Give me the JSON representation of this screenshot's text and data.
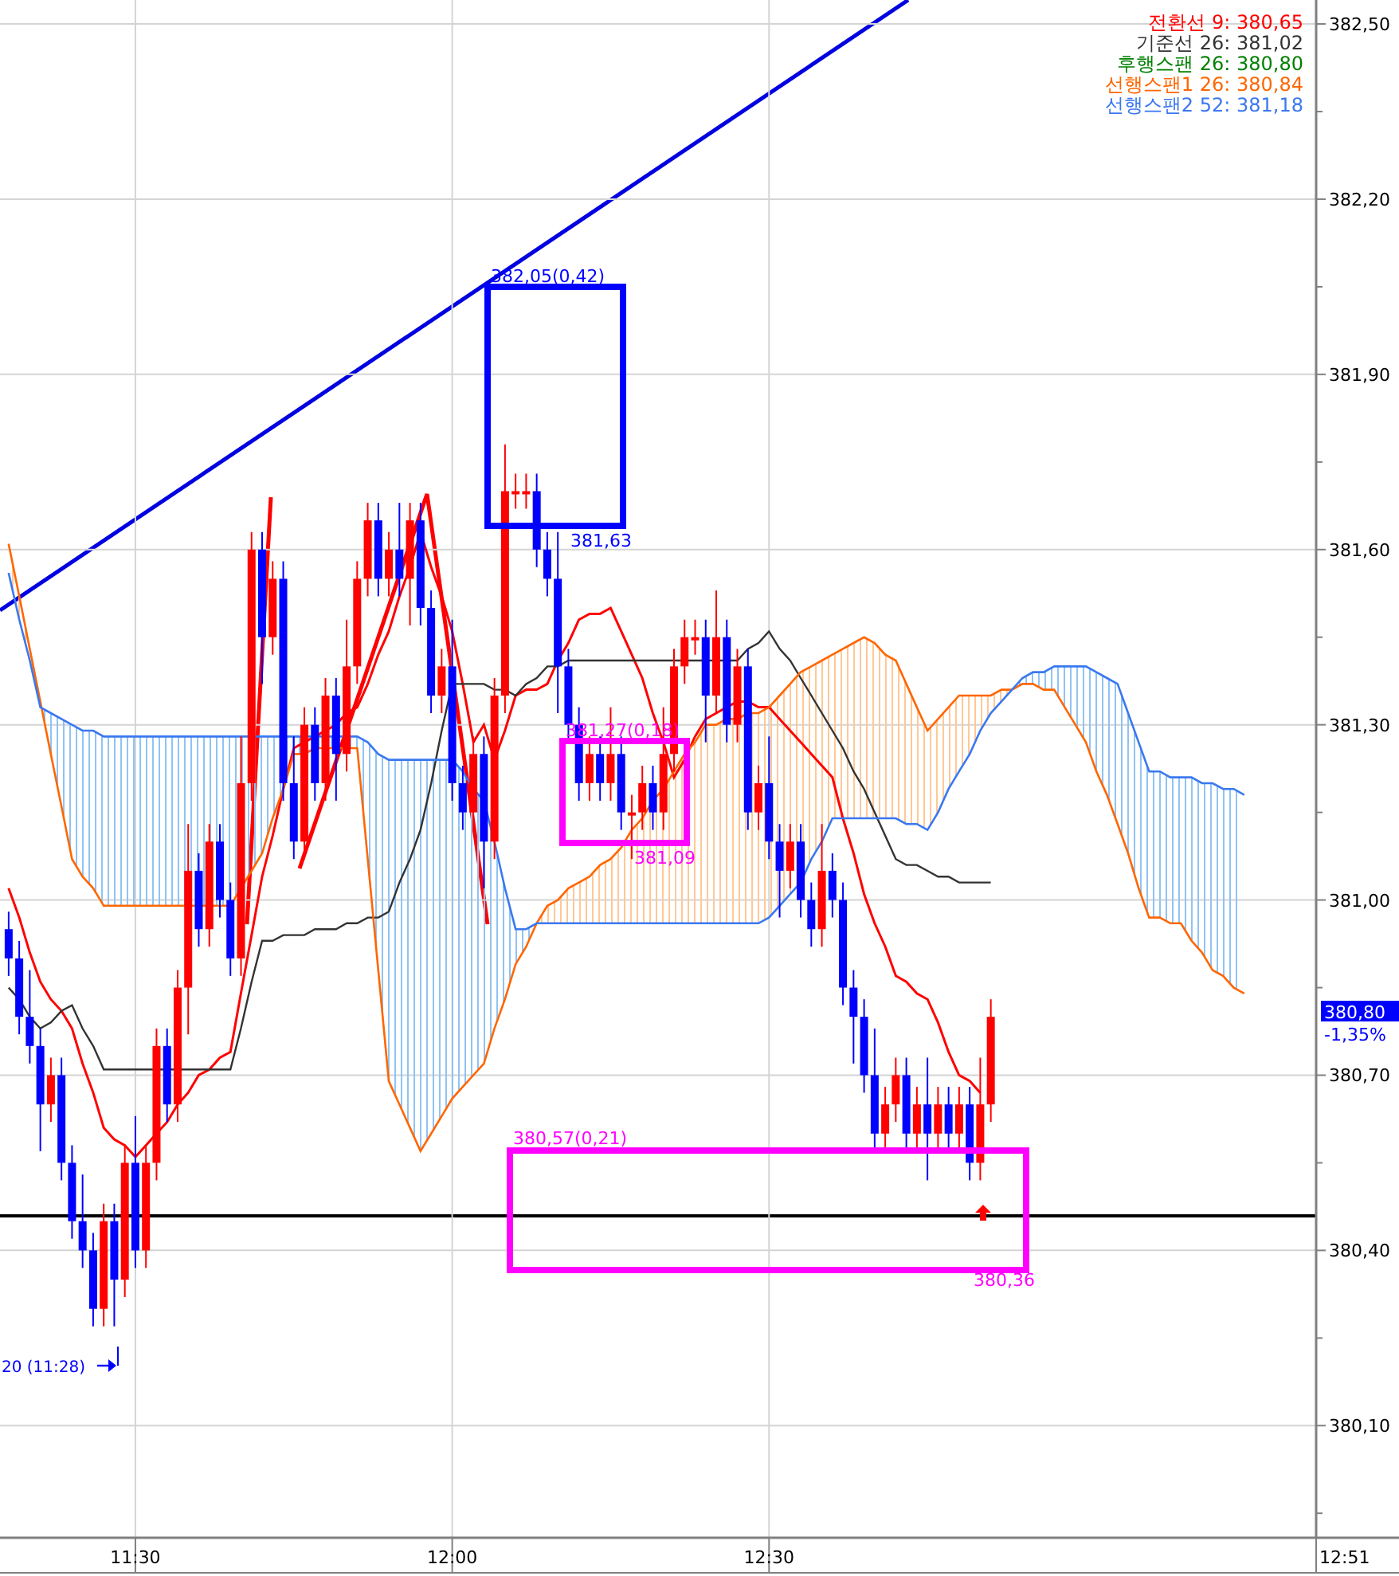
{
  "legend": [
    {
      "label": "전환선 9: 380,65",
      "color": "#ff0000"
    },
    {
      "label": "기준선 26: 381,02",
      "color": "#333333"
    },
    {
      "label": "후행스팬 26: 380,80",
      "color": "#008000"
    },
    {
      "label": "선행스팬1 26: 380,84",
      "color": "#ff6600"
    },
    {
      "label": "선행스팬2 52: 381,18",
      "color": "#3a78f0"
    }
  ],
  "chart_data": {
    "type": "candlestick",
    "grid": true,
    "ylim": [
      379.908,
      382.541
    ],
    "yticks": [
      {
        "value": 382.5,
        "label": "382,50"
      },
      {
        "value": 382.2,
        "label": "382,20"
      },
      {
        "value": 381.9,
        "label": "381,90"
      },
      {
        "value": 381.6,
        "label": "381,60"
      },
      {
        "value": 381.3,
        "label": "381,30"
      },
      {
        "value": 381.0,
        "label": "381,00"
      },
      {
        "value": 380.7,
        "label": "380,70"
      },
      {
        "value": 380.4,
        "label": "380,40"
      },
      {
        "value": 380.1,
        "label": "380,10"
      }
    ],
    "xlim": [
      677.18,
      809.65
    ],
    "xticks": [
      {
        "value": 690,
        "label": "11:30"
      },
      {
        "value": 720,
        "label": "12:00"
      },
      {
        "value": 750,
        "label": "12:30"
      }
    ],
    "x": [
      678,
      679,
      680,
      681,
      682,
      683,
      684,
      685,
      686,
      687,
      688,
      689,
      690,
      691,
      692,
      693,
      694,
      695,
      696,
      697,
      698,
      699,
      700,
      701,
      702,
      703,
      704,
      705,
      706,
      707,
      708,
      709,
      710,
      711,
      712,
      713,
      714,
      715,
      716,
      717,
      718,
      719,
      720,
      721,
      722,
      723,
      724,
      725,
      726,
      727,
      728,
      729,
      730,
      731,
      732,
      733,
      734,
      735,
      736,
      737,
      738,
      739,
      740,
      741,
      742,
      743,
      744,
      745,
      746,
      747,
      748,
      749,
      750,
      751,
      752,
      753,
      754,
      755,
      756,
      757,
      758,
      759,
      760,
      761,
      762,
      763,
      764,
      765,
      766,
      767,
      768,
      769,
      770,
      771,
      772,
      773,
      774,
      775,
      776,
      777,
      778,
      779,
      780,
      781,
      782,
      783,
      784,
      785,
      786,
      787,
      788,
      789,
      790,
      791,
      792,
      793,
      794,
      795
    ],
    "ohlc": [
      [
        380.95,
        380.98,
        380.87,
        380.9
      ],
      [
        380.9,
        380.93,
        380.77,
        380.8
      ],
      [
        380.8,
        380.88,
        380.72,
        380.75
      ],
      [
        380.75,
        380.78,
        380.57,
        380.65
      ],
      [
        380.65,
        380.73,
        380.62,
        380.7
      ],
      [
        380.7,
        380.73,
        380.52,
        380.55
      ],
      [
        380.55,
        380.58,
        380.42,
        380.45
      ],
      [
        380.45,
        380.53,
        380.37,
        380.4
      ],
      [
        380.4,
        380.43,
        380.27,
        380.3
      ],
      [
        380.3,
        380.48,
        380.27,
        380.45
      ],
      [
        380.45,
        380.48,
        380.27,
        380.35
      ],
      [
        380.35,
        380.58,
        380.32,
        380.55
      ],
      [
        380.55,
        380.63,
        380.37,
        380.4
      ],
      [
        380.4,
        380.58,
        380.37,
        380.55
      ],
      [
        380.55,
        380.78,
        380.52,
        380.75
      ],
      [
        380.75,
        380.78,
        380.62,
        380.65
      ],
      [
        380.65,
        380.88,
        380.62,
        380.85
      ],
      [
        380.85,
        381.13,
        380.77,
        381.05
      ],
      [
        381.05,
        381.08,
        380.92,
        380.95
      ],
      [
        380.95,
        381.13,
        380.92,
        381.1
      ],
      [
        381.1,
        381.13,
        380.97,
        381.0
      ],
      [
        381.0,
        381.03,
        380.87,
        380.9
      ],
      [
        380.9,
        381.28,
        380.87,
        381.2
      ],
      [
        381.2,
        381.63,
        381.17,
        381.6
      ],
      [
        381.6,
        381.63,
        381.37,
        381.45
      ],
      [
        381.45,
        381.58,
        381.42,
        381.55
      ],
      [
        381.55,
        381.58,
        381.17,
        381.2
      ],
      [
        381.2,
        381.28,
        381.07,
        381.1
      ],
      [
        381.1,
        381.33,
        381.07,
        381.3
      ],
      [
        381.3,
        381.33,
        381.17,
        381.2
      ],
      [
        381.2,
        381.38,
        381.17,
        381.35
      ],
      [
        381.35,
        381.38,
        381.17,
        381.25
      ],
      [
        381.25,
        381.48,
        381.22,
        381.4
      ],
      [
        381.4,
        381.58,
        381.37,
        381.55
      ],
      [
        381.55,
        381.68,
        381.52,
        381.65
      ],
      [
        381.65,
        381.68,
        381.52,
        381.55
      ],
      [
        381.55,
        381.63,
        381.52,
        381.6
      ],
      [
        381.6,
        381.68,
        381.52,
        381.55
      ],
      [
        381.55,
        381.68,
        381.47,
        381.65
      ],
      [
        381.65,
        381.68,
        381.47,
        381.5
      ],
      [
        381.5,
        381.53,
        381.32,
        381.35
      ],
      [
        381.35,
        381.43,
        381.32,
        381.4
      ],
      [
        381.4,
        381.48,
        381.17,
        381.2
      ],
      [
        381.2,
        381.23,
        381.12,
        381.15
      ],
      [
        381.15,
        381.28,
        381.12,
        381.25
      ],
      [
        381.25,
        381.28,
        381.02,
        381.1
      ],
      [
        381.1,
        381.38,
        381.07,
        381.35
      ],
      [
        381.35,
        381.78,
        381.32,
        381.7
      ],
      [
        381.7,
        381.73,
        381.67,
        381.7
      ],
      [
        381.7,
        381.73,
        381.67,
        381.7
      ],
      [
        381.7,
        381.73,
        381.57,
        381.6
      ],
      [
        381.6,
        381.63,
        381.52,
        381.55
      ],
      [
        381.55,
        381.63,
        381.32,
        381.4
      ],
      [
        381.4,
        381.43,
        381.27,
        381.3
      ],
      [
        381.3,
        381.33,
        381.17,
        381.2
      ],
      [
        381.2,
        381.28,
        381.17,
        381.25
      ],
      [
        381.25,
        381.28,
        381.17,
        381.2
      ],
      [
        381.2,
        381.33,
        381.17,
        381.25
      ],
      [
        381.25,
        381.28,
        381.12,
        381.15
      ],
      [
        381.15,
        381.18,
        381.07,
        381.15
      ],
      [
        381.15,
        381.23,
        381.12,
        381.2
      ],
      [
        381.2,
        381.23,
        381.12,
        381.15
      ],
      [
        381.15,
        381.33,
        381.12,
        381.25
      ],
      [
        381.25,
        381.43,
        381.22,
        381.4
      ],
      [
        381.4,
        381.48,
        381.37,
        381.45
      ],
      [
        381.45,
        381.48,
        381.42,
        381.45
      ],
      [
        381.45,
        381.48,
        381.27,
        381.35
      ],
      [
        381.35,
        381.53,
        381.32,
        381.45
      ],
      [
        381.45,
        381.48,
        381.27,
        381.3
      ],
      [
        381.3,
        381.43,
        381.27,
        381.4
      ],
      [
        381.4,
        381.43,
        381.12,
        381.15
      ],
      [
        381.15,
        381.23,
        381.12,
        381.2
      ],
      [
        381.2,
        381.28,
        381.07,
        381.1
      ],
      [
        381.1,
        381.13,
        380.97,
        381.05
      ],
      [
        381.05,
        381.13,
        381.02,
        381.1
      ],
      [
        381.1,
        381.13,
        380.97,
        381.0
      ],
      [
        381.0,
        381.03,
        380.92,
        380.95
      ],
      [
        380.95,
        381.13,
        380.92,
        381.05
      ],
      [
        381.05,
        381.08,
        380.97,
        381.0
      ],
      [
        381.0,
        381.03,
        380.82,
        380.85
      ],
      [
        380.85,
        380.88,
        380.72,
        380.8
      ],
      [
        380.8,
        380.83,
        380.67,
        380.7
      ],
      [
        380.7,
        380.78,
        380.57,
        380.6
      ],
      [
        380.6,
        380.68,
        380.57,
        380.65
      ],
      [
        380.65,
        380.73,
        380.62,
        380.7
      ],
      [
        380.7,
        380.73,
        380.57,
        380.6
      ],
      [
        380.6,
        380.68,
        380.57,
        380.65
      ],
      [
        380.65,
        380.73,
        380.52,
        380.6
      ],
      [
        380.6,
        380.68,
        380.57,
        380.65
      ],
      [
        380.65,
        380.68,
        380.57,
        380.6
      ],
      [
        380.6,
        380.68,
        380.57,
        380.65
      ],
      [
        380.65,
        380.68,
        380.52,
        380.55
      ],
      [
        380.55,
        380.73,
        380.52,
        380.65
      ],
      [
        380.65,
        380.83,
        380.62,
        380.8
      ],
      null,
      null,
      null,
      null,
      null,
      null,
      null,
      null,
      null,
      null,
      null,
      null,
      null,
      null,
      null,
      null,
      null,
      null,
      null,
      null,
      null,
      null,
      null,
      null
    ],
    "series": [
      {
        "type": "line",
        "color": "#ff0000",
        "values": [
          381.02,
          380.97,
          380.91,
          380.86,
          380.83,
          380.81,
          380.78,
          380.72,
          380.67,
          380.61,
          380.59,
          380.58,
          380.56,
          380.58,
          380.6,
          380.62,
          380.65,
          380.67,
          380.7,
          380.71,
          380.73,
          380.74,
          380.84,
          380.94,
          381.04,
          381.11,
          381.19,
          381.26,
          381.27,
          381.28,
          381.29,
          381.3,
          381.32,
          381.33,
          381.37,
          381.42,
          381.46,
          381.52,
          381.57,
          381.63,
          381.57,
          381.52,
          381.46,
          381.37,
          381.27,
          381.3,
          381.24,
          381.29,
          381.35,
          381.36,
          381.36,
          381.37,
          381.41,
          381.44,
          381.48,
          381.49,
          381.49,
          381.5,
          381.46,
          381.42,
          381.38,
          381.32,
          381.27,
          381.21,
          381.24,
          381.28,
          381.31,
          381.32,
          381.33,
          381.34,
          381.34,
          381.33,
          381.33,
          381.31,
          381.29,
          381.27,
          381.25,
          381.23,
          381.21,
          381.14,
          381.08,
          381.01,
          380.96,
          380.92,
          380.87,
          380.86,
          380.84,
          380.83,
          380.79,
          380.74,
          380.7,
          380.69,
          380.67,
          null,
          null,
          null,
          null,
          null,
          null,
          null,
          null,
          null,
          null,
          null,
          null,
          null,
          null,
          null,
          null,
          null,
          null,
          null,
          null,
          null,
          null,
          null,
          null,
          null
        ]
      },
      {
        "type": "line",
        "color": "#333333",
        "values": [
          380.85,
          380.83,
          380.8,
          380.78,
          380.79,
          380.81,
          380.82,
          380.78,
          380.75,
          380.71,
          380.71,
          380.71,
          380.71,
          380.71,
          380.71,
          380.71,
          380.71,
          380.71,
          380.71,
          380.71,
          380.71,
          380.71,
          380.78,
          380.86,
          380.93,
          380.93,
          380.94,
          380.94,
          380.94,
          380.95,
          380.95,
          380.95,
          380.96,
          380.96,
          380.97,
          380.97,
          380.98,
          381.03,
          381.07,
          381.12,
          381.2,
          381.29,
          381.37,
          381.37,
          381.37,
          381.37,
          381.36,
          381.36,
          381.35,
          381.37,
          381.38,
          381.4,
          381.4,
          381.41,
          381.41,
          381.41,
          381.41,
          381.41,
          381.41,
          381.41,
          381.41,
          381.41,
          381.41,
          381.41,
          381.41,
          381.41,
          381.41,
          381.41,
          381.41,
          381.41,
          381.43,
          381.44,
          381.46,
          381.43,
          381.41,
          381.38,
          381.35,
          381.32,
          381.29,
          381.26,
          381.22,
          381.19,
          381.15,
          381.11,
          381.07,
          381.06,
          381.06,
          381.05,
          381.04,
          381.04,
          381.03,
          381.03,
          381.03,
          381.03,
          null,
          null,
          null,
          null,
          null,
          null,
          null,
          null,
          null,
          null,
          null,
          null,
          null,
          null,
          null,
          null,
          null,
          null,
          null,
          null,
          null,
          null,
          null,
          null
        ]
      },
      {
        "type": "line",
        "color": "#ff6600",
        "values": [
          381.61,
          381.52,
          381.43,
          381.34,
          381.25,
          381.16,
          381.07,
          381.04,
          381.02,
          380.99,
          380.99,
          380.99,
          380.99,
          380.99,
          380.99,
          380.99,
          380.99,
          380.99,
          380.99,
          380.99,
          380.99,
          380.99,
          381.02,
          381.05,
          381.08,
          381.14,
          381.19,
          381.25,
          381.25,
          381.26,
          381.26,
          381.26,
          381.26,
          381.26,
          381.07,
          380.88,
          380.69,
          380.65,
          380.61,
          380.57,
          380.6,
          380.63,
          380.66,
          380.68,
          380.7,
          380.72,
          380.78,
          380.83,
          380.89,
          380.92,
          380.96,
          380.99,
          381.0,
          381.02,
          381.03,
          381.04,
          381.06,
          381.07,
          381.09,
          381.12,
          381.14,
          381.17,
          381.19,
          381.22,
          381.25,
          381.27,
          381.3,
          381.3,
          381.31,
          381.31,
          381.32,
          381.32,
          381.33,
          381.35,
          381.37,
          381.39,
          381.4,
          381.41,
          381.42,
          381.43,
          381.44,
          381.45,
          381.44,
          381.42,
          381.41,
          381.37,
          381.33,
          381.29,
          381.31,
          381.33,
          381.35,
          381.35,
          381.35,
          381.35,
          381.36,
          381.36,
          381.37,
          381.37,
          381.36,
          381.36,
          381.33,
          381.3,
          381.27,
          381.22,
          381.18,
          381.13,
          381.08,
          381.02,
          380.97,
          380.97,
          380.96,
          380.96,
          380.93,
          380.91,
          380.88,
          380.87,
          380.85,
          380.84
        ]
      },
      {
        "type": "line",
        "color": "#3a78f0",
        "values": [
          381.56,
          381.48,
          381.41,
          381.33,
          381.32,
          381.31,
          381.3,
          381.29,
          381.29,
          381.28,
          381.28,
          381.28,
          381.28,
          381.28,
          381.28,
          381.28,
          381.28,
          381.28,
          381.28,
          381.28,
          381.28,
          381.28,
          381.28,
          381.28,
          381.28,
          381.28,
          381.28,
          381.28,
          381.28,
          381.28,
          381.28,
          381.28,
          381.28,
          381.28,
          381.27,
          381.25,
          381.24,
          381.24,
          381.24,
          381.24,
          381.24,
          381.24,
          381.24,
          381.22,
          381.19,
          381.17,
          381.1,
          381.02,
          380.95,
          380.95,
          380.96,
          380.96,
          380.96,
          380.96,
          380.96,
          380.96,
          380.96,
          380.96,
          380.96,
          380.96,
          380.96,
          380.96,
          380.96,
          380.96,
          380.96,
          380.96,
          380.96,
          380.96,
          380.96,
          380.96,
          380.96,
          380.96,
          380.97,
          380.99,
          381.01,
          381.03,
          381.07,
          381.1,
          381.14,
          381.14,
          381.14,
          381.14,
          381.14,
          381.14,
          381.14,
          381.13,
          381.13,
          381.12,
          381.15,
          381.19,
          381.22,
          381.25,
          381.29,
          381.32,
          381.34,
          381.36,
          381.38,
          381.39,
          381.39,
          381.4,
          381.4,
          381.4,
          381.4,
          381.39,
          381.38,
          381.37,
          381.32,
          381.27,
          381.22,
          381.22,
          381.21,
          381.21,
          381.21,
          381.2,
          381.2,
          381.19,
          381.19,
          381.18
        ]
      }
    ]
  },
  "price_axis": {
    "last_price": "380,80",
    "change": "-1,35%"
  },
  "time_axis": {
    "last_label": "12:51"
  },
  "boxes": [
    {
      "color": "#0000ff",
      "top_label": "382,05(0,42)",
      "bottom_label": "381,63"
    },
    {
      "color": "#ff00ff",
      "top_label": "381,27(0,18)",
      "bottom_label": "381,09"
    },
    {
      "color": "#ff00ff",
      "top_label": "380,57(0,21)",
      "bottom_label": "380,36"
    }
  ],
  "low_marker": {
    "text": "20 (11:28)"
  }
}
